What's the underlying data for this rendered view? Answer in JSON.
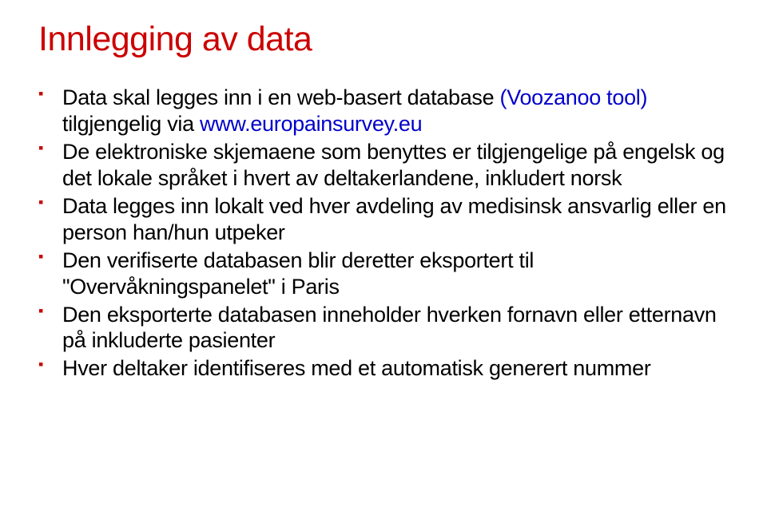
{
  "title": "Innlegging av data",
  "bullets": [
    {
      "parts": [
        {
          "text": "Data skal legges inn i en web-basert database ",
          "accent": false
        },
        {
          "text": "(Voozanoo tool) ",
          "accent": true
        },
        {
          "text": "tilgjengelig via ",
          "accent": false
        },
        {
          "text": "www.europainsurvey.eu",
          "accent": true
        }
      ]
    },
    {
      "parts": [
        {
          "text": "De elektroniske skjemaene som benyttes er tilgjengelige på engelsk og det lokale språket i hvert av deltakerlandene, inkludert norsk",
          "accent": false
        }
      ]
    },
    {
      "parts": [
        {
          "text": "Data legges inn lokalt ved hver avdeling av medisinsk ansvarlig eller en person han/hun utpeker",
          "accent": false
        }
      ]
    },
    {
      "parts": [
        {
          "text": "Den verifiserte databasen blir deretter eksportert til \"Overvåkningspanelet\" i Paris",
          "accent": false
        }
      ]
    },
    {
      "parts": [
        {
          "text": "Den eksporterte databasen inneholder hverken fornavn eller etternavn på inkluderte pasienter",
          "accent": false
        }
      ]
    },
    {
      "parts": [
        {
          "text": "Hver deltaker identifiseres med et automatisk generert nummer",
          "accent": false
        }
      ]
    }
  ]
}
